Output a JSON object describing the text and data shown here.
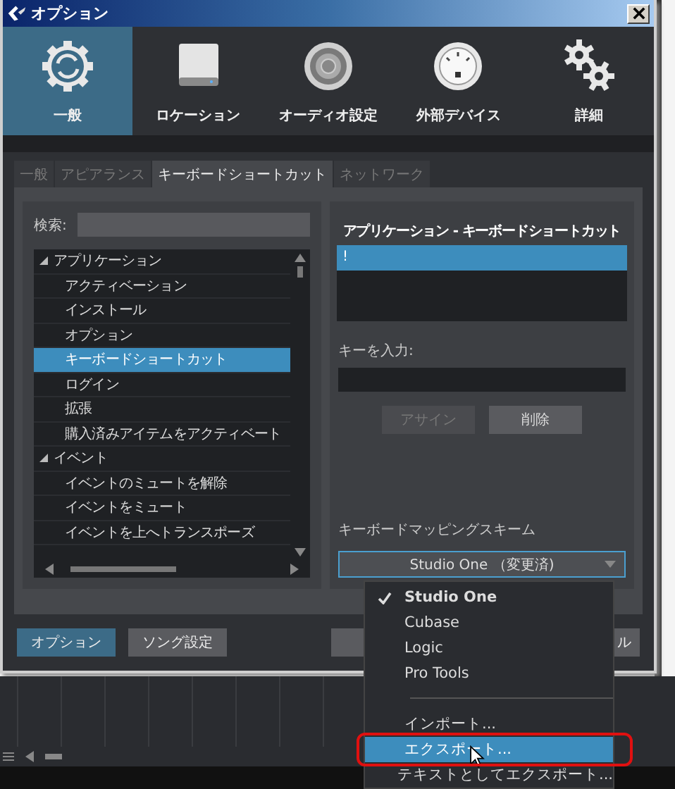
{
  "window": {
    "title": "オプション"
  },
  "categories": [
    {
      "label": "一般",
      "selected": true
    },
    {
      "label": "ロケーション",
      "selected": false
    },
    {
      "label": "オーディオ設定",
      "selected": false
    },
    {
      "label": "外部デバイス",
      "selected": false
    },
    {
      "label": "詳細",
      "selected": false
    }
  ],
  "tabs": [
    {
      "label": "一般",
      "selected": false
    },
    {
      "label": "アピアランス",
      "selected": false
    },
    {
      "label": "キーボードショートカット",
      "selected": true
    },
    {
      "label": "ネットワーク",
      "selected": false
    }
  ],
  "search": {
    "label": "検索:"
  },
  "tree": [
    {
      "label": "アプリケーション",
      "expanded": true,
      "children": [
        {
          "label": "アクティベーション",
          "selected": false
        },
        {
          "label": "インストール",
          "selected": false
        },
        {
          "label": "オプション",
          "selected": false
        },
        {
          "label": "キーボードショートカット",
          "selected": true
        },
        {
          "label": "ログイン",
          "selected": false
        },
        {
          "label": "拡張",
          "selected": false
        },
        {
          "label": "購入済みアイテムをアクティベート",
          "selected": false
        }
      ]
    },
    {
      "label": "イベント",
      "expanded": true,
      "children": [
        {
          "label": "イベントのミュートを解除",
          "selected": false
        },
        {
          "label": "イベントをミュート",
          "selected": false
        },
        {
          "label": "イベントを上へトランスポーズ",
          "selected": false
        }
      ]
    }
  ],
  "shortcut_list": {
    "header": "アプリケーション - キーボードショートカット",
    "rows": [
      {
        "label": "!",
        "selected": true
      }
    ]
  },
  "key_input": {
    "label": "キーを入力:"
  },
  "key_buttons": [
    {
      "label": "アサイン",
      "disabled": true
    },
    {
      "label": "削除",
      "disabled": false
    }
  ],
  "scheme": {
    "label": "キーボードマッピングスキーム",
    "value": "Studio One （変更済)"
  },
  "footer_buttons": [
    {
      "label": "オプション",
      "selected": true
    },
    {
      "label": "ソング設定",
      "selected": false
    }
  ],
  "footer_right_button": {
    "label": "ル"
  },
  "scheme_menu": [
    {
      "kind": "option",
      "label": "Studio One",
      "checked": true,
      "highlighted": false
    },
    {
      "kind": "option",
      "label": "Cubase",
      "checked": false,
      "highlighted": false
    },
    {
      "kind": "option",
      "label": "Logic",
      "checked": false,
      "highlighted": false
    },
    {
      "kind": "option",
      "label": "Pro Tools",
      "checked": false,
      "highlighted": false
    },
    {
      "kind": "separator"
    },
    {
      "kind": "action",
      "label": "インポート...",
      "highlighted": false,
      "circled": false
    },
    {
      "kind": "action",
      "label": "エクスポート...",
      "highlighted": true,
      "circled": true
    },
    {
      "kind": "action",
      "label": "テキストとしてエクスポート...",
      "highlighted": false,
      "circled": false
    }
  ]
}
